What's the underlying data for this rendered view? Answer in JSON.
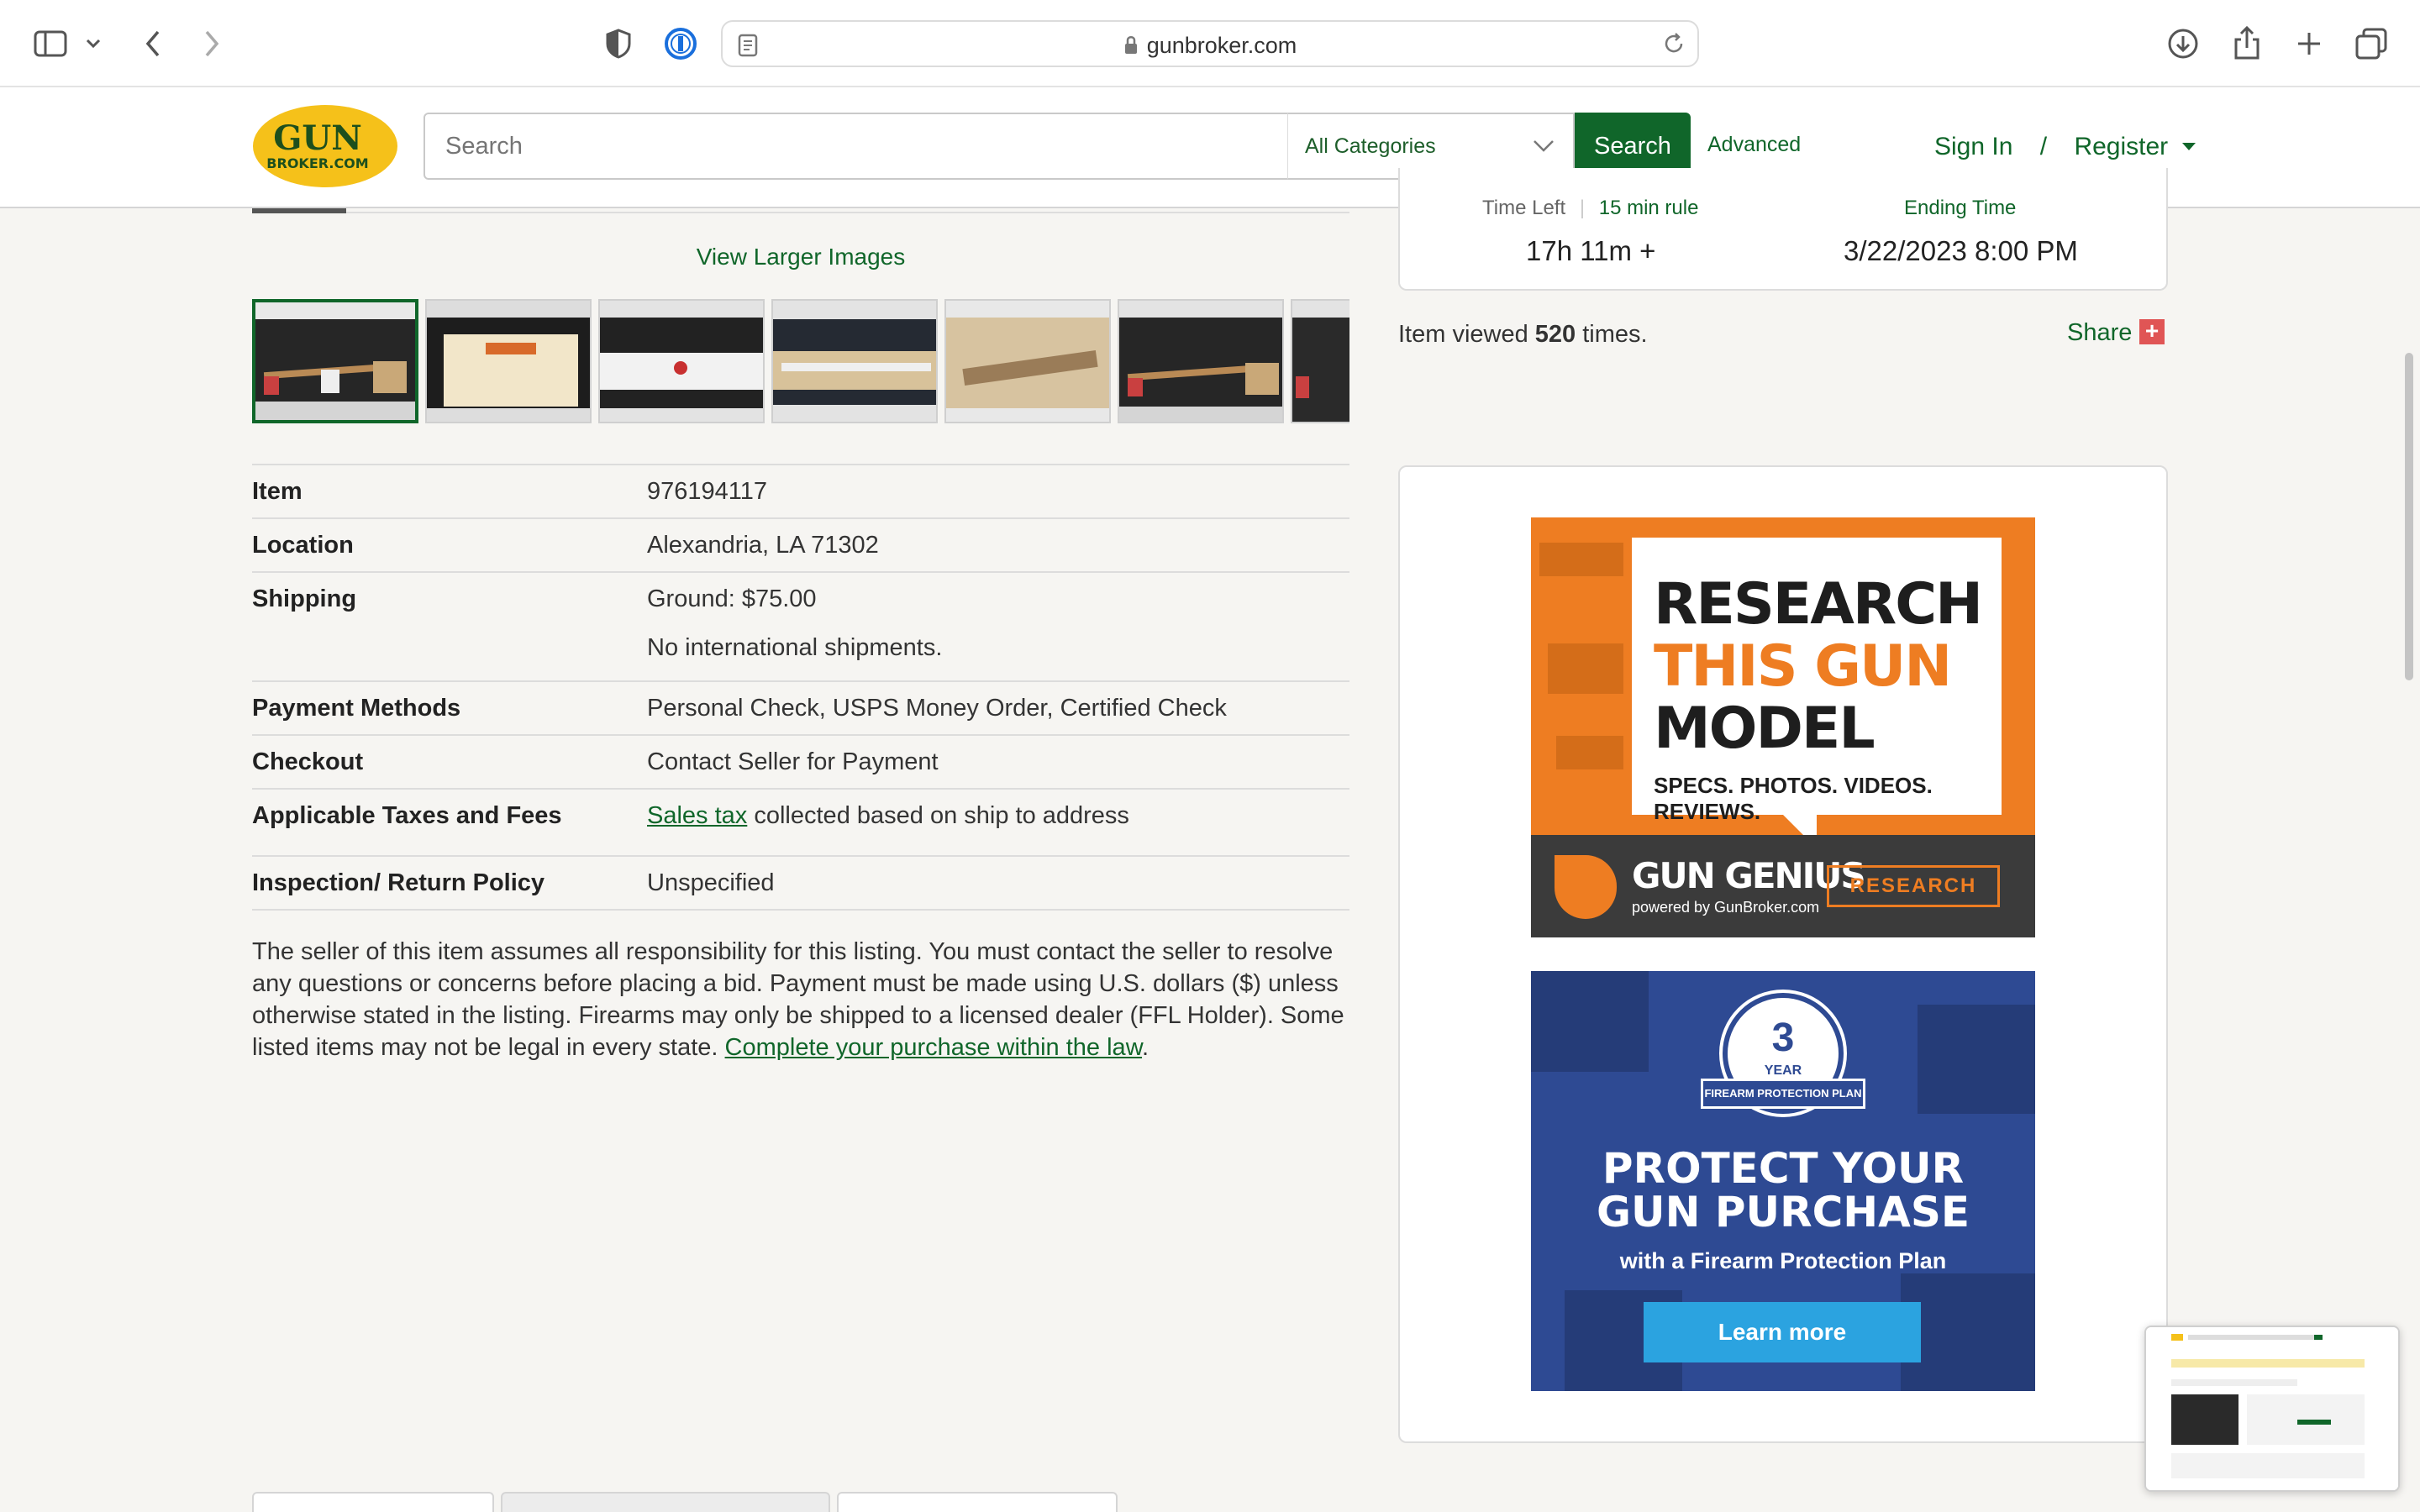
{
  "browser": {
    "url": "gunbroker.com",
    "icons": {
      "sidebar": "sidebar-icon",
      "back": "chevron-left-icon",
      "forward": "chevron-right-icon",
      "shield": "privacy-shield-icon",
      "password": "password-manager-icon",
      "reader": "reader-icon",
      "lock": "lock-icon",
      "reload": "reload-icon",
      "download": "download-icon",
      "share": "share-icon",
      "new_tab": "plus-icon",
      "tabs": "tabs-overview-icon"
    }
  },
  "header": {
    "logo_top": "GUN",
    "logo_bottom": "BROKER.COM",
    "search_placeholder": "Search",
    "category": "All Categories",
    "search_button": "Search",
    "advanced": "Advanced",
    "sign_in": "Sign In",
    "separator": "/",
    "register": "Register"
  },
  "gallery": {
    "view_larger": "View Larger Images",
    "thumbnail_count": 7
  },
  "auction": {
    "time_left_label": "Time Left",
    "rule_label": "15 min rule",
    "ending_label": "Ending Time",
    "time_left": "17h 11m +",
    "ending_time": "3/22/2023 8:00 PM",
    "viewed_prefix": "Item viewed",
    "viewed_count": "520",
    "viewed_suffix": "times.",
    "share": "Share",
    "share_plus": "+"
  },
  "details": {
    "item_label": "Item",
    "item_value": "976194117",
    "location_label": "Location",
    "location_value": "Alexandria, LA 71302",
    "shipping_label": "Shipping",
    "shipping_value": "Ground: $75.00",
    "shipping_note": "No international shipments.",
    "payment_label": "Payment Methods",
    "payment_value": "Personal Check, USPS Money Order, Certified Check",
    "checkout_label": "Checkout",
    "checkout_value": "Contact Seller for Payment",
    "taxes_label": "Applicable Taxes and Fees",
    "taxes_link": "Sales tax",
    "taxes_rest": "collected based on ship to address",
    "inspection_label": "Inspection/ Return Policy",
    "inspection_value": "Unspecified"
  },
  "disclaimer": {
    "text": "The seller of this item assumes all responsibility for this listing. You must contact the seller to resolve any questions or concerns before placing a bid. Payment must be made using U.S. dollars ($) unless otherwise stated in the listing. Firearms may only be shipped to a licensed dealer (FFL Holder). Some listed items may not be legal in every state.",
    "link": "Complete your purchase within the law",
    "end": "."
  },
  "ads": {
    "research": {
      "line1": "RESEARCH",
      "line2": "THIS GUN",
      "line3": "MODEL",
      "line4": "SPECS. PHOTOS. VIDEOS. REVIEWS.",
      "brand": "GUN GENIUS",
      "powered": "powered by GunBroker.com",
      "button": "RESEARCH",
      "accent": "#ee7d22"
    },
    "protect": {
      "badge_num": "3",
      "badge_year": "YEAR",
      "badge_ribbon": "FIREARM PROTECTION PLAN",
      "line1": "PROTECT YOUR",
      "line2": "GUN PURCHASE",
      "line3": "with a Firearm Protection Plan",
      "button": "Learn more",
      "accent": "#2e4a93"
    }
  },
  "colors": {
    "brand_green": "#10662a",
    "logo_yellow": "#f5c11a"
  }
}
